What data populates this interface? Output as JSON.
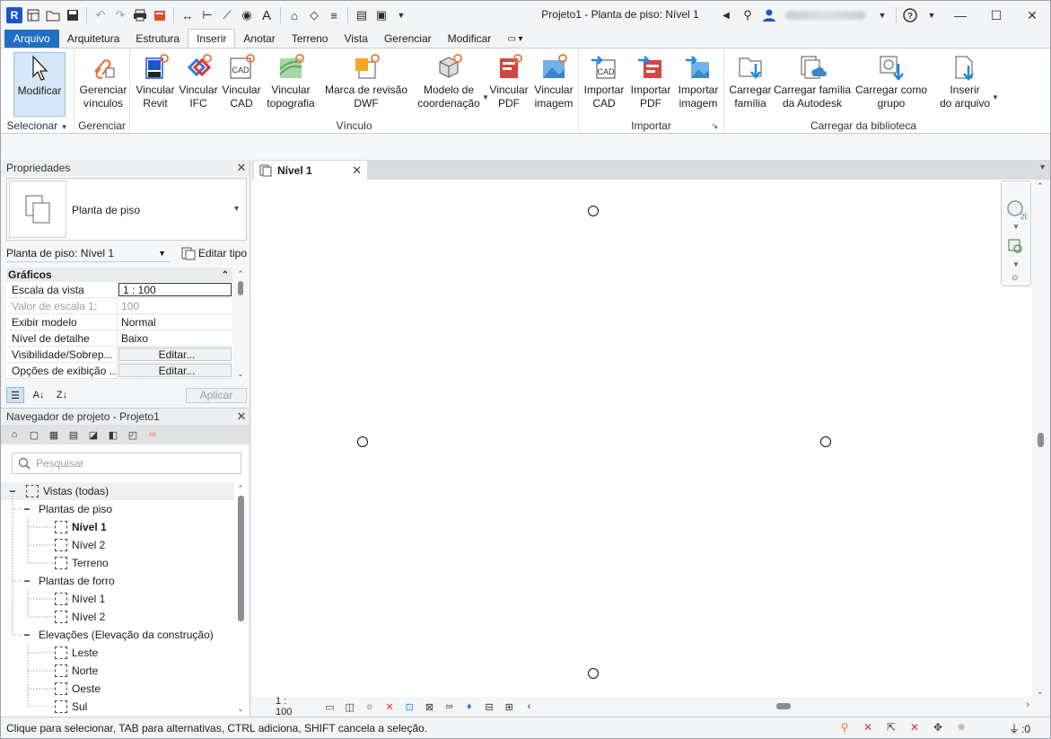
{
  "window": {
    "title": "Projeto1 - Planta de piso: Nível 1",
    "help_icon": "?"
  },
  "tabs": [
    {
      "label": "Arquivo"
    },
    {
      "label": "Arquitetura"
    },
    {
      "label": "Estrutura"
    },
    {
      "label": "Inserir"
    },
    {
      "label": "Anotar"
    },
    {
      "label": "Terreno"
    },
    {
      "label": "Vista"
    },
    {
      "label": "Gerenciar"
    },
    {
      "label": "Modificar"
    }
  ],
  "ribbon": {
    "panels": {
      "selecionar": "Selecionar",
      "gerenciar": "Gerenciar",
      "vinculo": "Vínculo",
      "importar": "Importar",
      "carregar": "Carregar da biblioteca"
    },
    "buttons": {
      "modificar": "Modificar",
      "gerenciar_vinculos": "Gerenciar\nvínculos",
      "vincular_revit": "Vincular\nRevit",
      "vincular_ifc": "Vincular\nIFC",
      "vincular_cad": "Vincular\nCAD",
      "vincular_topografia": "Vincular\ntopografia",
      "marca_revisao_dwf": "Marca de revisão\nDWF",
      "modelo_coordenacao": "Modelo de\ncoordenação",
      "vincular_pdf": "Vincular\nPDF",
      "vincular_imagem": "Vincular\nimagem",
      "importar_cad": "Importar\nCAD",
      "importar_pdf": "Importar\nPDF",
      "importar_imagem": "Importar\nimagem",
      "carregar_familia": "Carregar\nfamília",
      "carregar_familia_autodesk": "Carregar família\nda Autodesk",
      "carregar_grupo": "Carregar como\ngrupo",
      "inserir_arquivo": "Inserir\ndo arquivo"
    }
  },
  "properties": {
    "title": "Propriedades",
    "type_name": "Planta de piso",
    "instance": "Planta de piso: Nível 1",
    "edit_type": "Editar tipo",
    "group": "Gráficos",
    "rows": [
      {
        "key": "Escala da vista",
        "value": "1 : 100"
      },
      {
        "key": "Valor de escala    1:",
        "value": "100"
      },
      {
        "key": "Exibir modelo",
        "value": "Normal"
      },
      {
        "key": "Nível de detalhe",
        "value": "Baixo"
      },
      {
        "key": "Visibilidade/Sobrep...",
        "value": "Editar..."
      },
      {
        "key": "Opções de exibição ...",
        "value": "Editar..."
      }
    ],
    "apply": "Aplicar"
  },
  "browser": {
    "title": "Navegador de projeto - Projeto1",
    "search_placeholder": "Pesquisar",
    "root": "Vistas (todas)",
    "floor_plans": "Plantas de piso",
    "fp_items": [
      "Nível 1",
      "Nível 2",
      "Terreno"
    ],
    "ceiling_plans": "Plantas de forro",
    "cp_items": [
      "Nível 1",
      "Nível 2"
    ],
    "elevations": "Elevações (Elevação da construção)",
    "el_items": [
      "Leste",
      "Norte",
      "Oeste",
      "Sul"
    ]
  },
  "view": {
    "tab": "Nível 1",
    "scale": "1 : 100"
  },
  "status": {
    "hint": "Clique para selecionar, TAB para alternativas, CTRL adiciona, SHIFT cancela a seleção.",
    "filter_count": ":0"
  }
}
